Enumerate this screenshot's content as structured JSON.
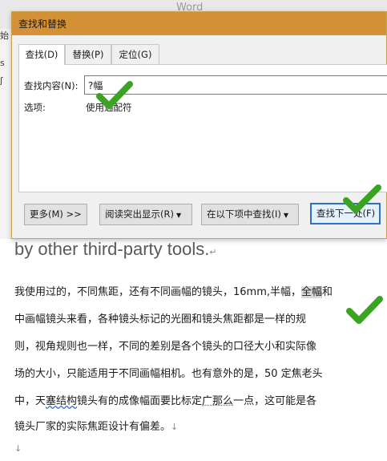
{
  "word": {
    "ghost_title": "Word",
    "left_strip": [
      "始",
      "s",
      "ʃ"
    ]
  },
  "dialog": {
    "title": "查找和替换",
    "tabs": [
      {
        "label": "查找(D)",
        "active": true
      },
      {
        "label": "替换(P)",
        "active": false
      },
      {
        "label": "定位(G)",
        "active": false
      }
    ],
    "find_label": "查找内容(N):",
    "find_value": "?幅",
    "options_label": "选项:",
    "options_value": "使用通配符",
    "buttons": {
      "more": "更多(M) >>",
      "reading_highlight": "阅读突出显示(R)",
      "find_in": "在以下项中查找(I)",
      "find_next": "查找下一处(F)"
    }
  },
  "document": {
    "english_line": "by other third-party tools.",
    "para_mark": "↵",
    "lines": [
      {
        "segments": [
          {
            "text": "我使用过的，不同焦距，还有不同画幅的镜头，16mm,半幅，",
            "style": ""
          },
          {
            "text": "全幅",
            "style": "hl"
          },
          {
            "text": "和",
            "style": ""
          }
        ]
      },
      {
        "segments": [
          {
            "text": "中画幅镜头来看，各种镜头标记的光圈和镜头焦距都是一样的规",
            "style": ""
          }
        ]
      },
      {
        "segments": [
          {
            "text": "则，视角规则也一样，不同的差别是各个镜头的口径大小和实际像",
            "style": ""
          }
        ]
      },
      {
        "segments": [
          {
            "text": "场的大小，只能适用于不同画幅相机。也有意外的是，50 定焦老头",
            "style": ""
          }
        ]
      },
      {
        "segments": [
          {
            "text": "中，天",
            "style": ""
          },
          {
            "text": "塞结构",
            "style": "wavy"
          },
          {
            "text": "镜头有的成像幅面要比标定",
            "style": ""
          },
          {
            "text": "广那么",
            "style": "dotted"
          },
          {
            "text": "一点，这可能是各",
            "style": ""
          }
        ]
      },
      {
        "segments": [
          {
            "text": "镜头厂家的实际焦距设计有偏差。",
            "style": ""
          },
          {
            "text": "↓",
            "style": "mark"
          }
        ]
      }
    ],
    "end_mark": "↓"
  },
  "annotations": {
    "check_icon_color": "#3aa321"
  }
}
